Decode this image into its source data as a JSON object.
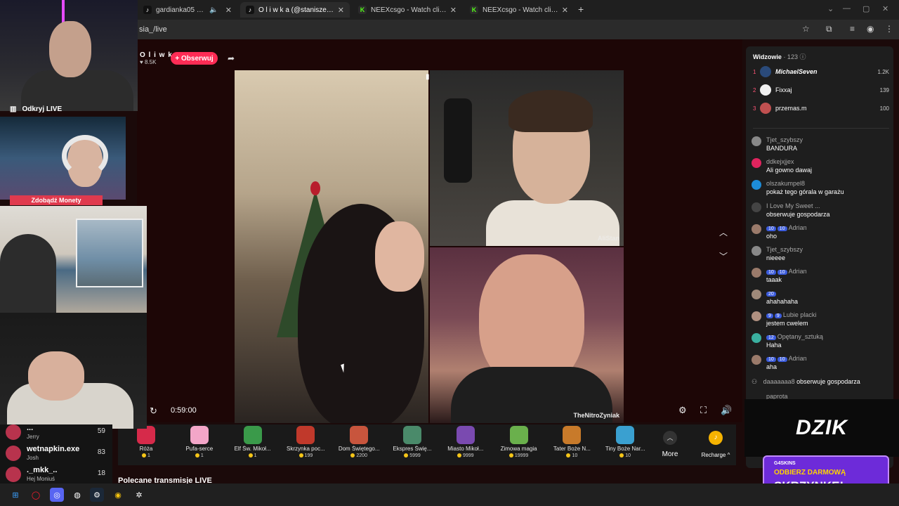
{
  "browser": {
    "tabs": [
      {
        "title": "gardianka05 (@gardianka05) ...",
        "favicon": "tiktok-icon",
        "muted": true,
        "active": false
      },
      {
        "title": "O l i w k a (@staniszesia_) j",
        "favicon": "tiktok-icon",
        "muted": false,
        "active": true
      },
      {
        "title": "NEEXcsgo - Watch clips on Kick",
        "favicon": "kick-icon",
        "muted": false,
        "active": false
      },
      {
        "title": "NEEXcsgo - Watch clips on Kick",
        "favicon": "kick-icon",
        "muted": false,
        "active": false
      }
    ],
    "new_tab": "+",
    "url": "sia_/live"
  },
  "host": {
    "name": "O l i w k a",
    "likes": "8.5K",
    "follow_label": "+ Obserwuj"
  },
  "feeds": {
    "b_label": "AliStan",
    "c_label": "TheNitroZyniak"
  },
  "player": {
    "timer": "0:59:00"
  },
  "gifts": [
    {
      "name": "Róża",
      "price": "1",
      "color": "#d62a4a"
    },
    {
      "name": "Pufa-serce",
      "price": "1",
      "color": "#f3a6c8"
    },
    {
      "name": "Elf Św. Mikoł...",
      "price": "1",
      "color": "#3a9a4a"
    },
    {
      "name": "Skrzynka poc...",
      "price": "199",
      "color": "#c0392b"
    },
    {
      "name": "Dom Świętego...",
      "price": "2200",
      "color": "#c8553d"
    },
    {
      "name": "Ekspres Świę...",
      "price": "5999",
      "color": "#4a8a6a"
    },
    {
      "name": "Miasto Mikoł...",
      "price": "9999",
      "color": "#7a4ab0"
    },
    {
      "name": "Zimowa magia",
      "price": "19999",
      "color": "#6ab04c"
    },
    {
      "name": "Tater Boże N...",
      "price": "10",
      "color": "#c87a2a"
    },
    {
      "name": "Tiny Boże Nar...",
      "price": "10",
      "color": "#3aa0d0"
    }
  ],
  "gift_bar": {
    "more": "More",
    "recharge": "Recharge"
  },
  "recommended": "Polecane transmisje LIVE",
  "viewers": {
    "title": "Widzowie",
    "count": "· 123",
    "ranking": [
      {
        "rank": "1",
        "name": "MichaelSeven",
        "score": "1.2K"
      },
      {
        "rank": "2",
        "name": "Fixxaj",
        "score": "139"
      },
      {
        "rank": "3",
        "name": "przemas.m",
        "score": "100"
      }
    ]
  },
  "chat": [
    {
      "user": "Tjet_szybszy",
      "text": "BANDURA",
      "avatar": "#888888"
    },
    {
      "user": "ddkejxjjex",
      "text": "Ali gowno dawaj",
      "avatar": "#e0245e"
    },
    {
      "user": "olszakumpel8",
      "text": "pokaż tego górala w garażu",
      "avatar": "#1d8cd8"
    },
    {
      "user": "I Love My Sweet ...",
      "text": "obserwuje gospodarza",
      "avatar": "#444444"
    },
    {
      "user": "Adrian",
      "badges": [
        "10",
        "10"
      ],
      "text": "oho",
      "avatar": "#9a7a6a"
    },
    {
      "user": "Tjet_szybszy",
      "text": "nieeee",
      "avatar": "#888888"
    },
    {
      "user": "Adrian",
      "badges": [
        "10",
        "10"
      ],
      "text": "taaak",
      "avatar": "#9a7a6a"
    },
    {
      "user": "",
      "badges": [
        "20"
      ],
      "text": "ahahahaha",
      "avatar": "#a08a7a"
    },
    {
      "user": "Lubie placki",
      "badges": [
        "9",
        "9"
      ],
      "text": "jestem cwelem",
      "avatar": "#b09080"
    },
    {
      "user": "Opętany_sztuką",
      "badges": [
        "12"
      ],
      "text": "Haha",
      "avatar": "#3ab0a0"
    },
    {
      "user": "Adrian",
      "badges": [
        "10",
        "10"
      ],
      "text": "aha",
      "avatar": "#9a7a6a"
    }
  ],
  "system_message": {
    "user": "daaaaaaa8",
    "text": "obserwuje gospodarza"
  },
  "last_user": "paprota",
  "ads": {
    "dzik": "DZIK",
    "skins_brand": "G4SKINS",
    "skins_line1": "ODBIERZ DARMOWĄ",
    "skins_line2": "SKRZYNKĘ!"
  },
  "overlay": {
    "odkryj": "Odkryj LIVE",
    "zdobadz": "Zdobądź Monety",
    "list": [
      {
        "name": "...",
        "sub": "Jerry",
        "count": "59"
      },
      {
        "name": "wetnapkin.exe",
        "sub": "Josh",
        "count": "83"
      },
      {
        "name": "._mkk_..",
        "sub": "Hej Moniuś",
        "count": "18"
      }
    ]
  }
}
